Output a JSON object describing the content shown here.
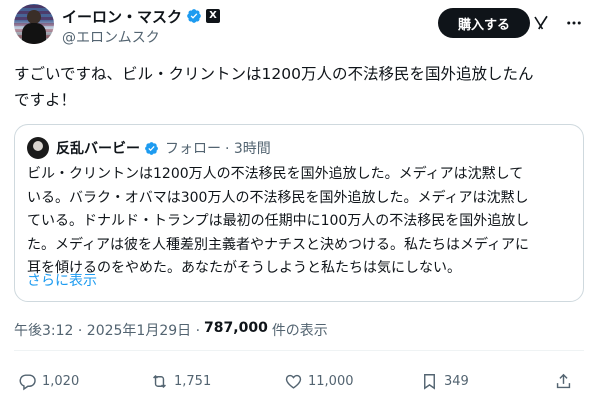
{
  "header": {
    "display_name": "イーロン・マスク",
    "x_badge": "X",
    "handle": "@エロンムスク",
    "buy_label": "購入する",
    "icons": [
      "verified-icon",
      "grok-icon",
      "more-icon"
    ]
  },
  "tweet": {
    "lines": [
      "すごいですね、ビル・クリントンは1200万人の不法移民を国外追放したん",
      "ですよ！"
    ]
  },
  "quote": {
    "name": "反乱バービー",
    "follow": "フォロー",
    "time": "· 3時間",
    "lines": [
      "ビル・クリントンは1200万人の不法移民を国外追放した。メディアは沈黙して",
      "いる。バラク・オバマは300万人の不法移民を国外追放した。メディアは沈黙し",
      "ている。ドナルド・トランプは最初の任期中に100万人の不法移民を国外追放し",
      "た。メディアは彼を人種差別主義者やナチスと決めつける。私たちはメディアに",
      "耳を傾けるのをやめた。あなたがそうしようと私たちは気にしない。"
    ],
    "more": "さらに表示"
  },
  "meta": {
    "time": "午後3:12 · 2025年1月29日 ·",
    "views": "787,000",
    "views_suffix": "件の表示"
  },
  "actions": {
    "replies": "1,020",
    "reposts": "1,751",
    "likes": "11,000",
    "bookmarks": "349"
  },
  "colors": {
    "text": "#0f1419",
    "secondary": "#536471",
    "link": "#1d9bf0",
    "verified": "#1d9bf0",
    "border": "#cfd9de"
  }
}
